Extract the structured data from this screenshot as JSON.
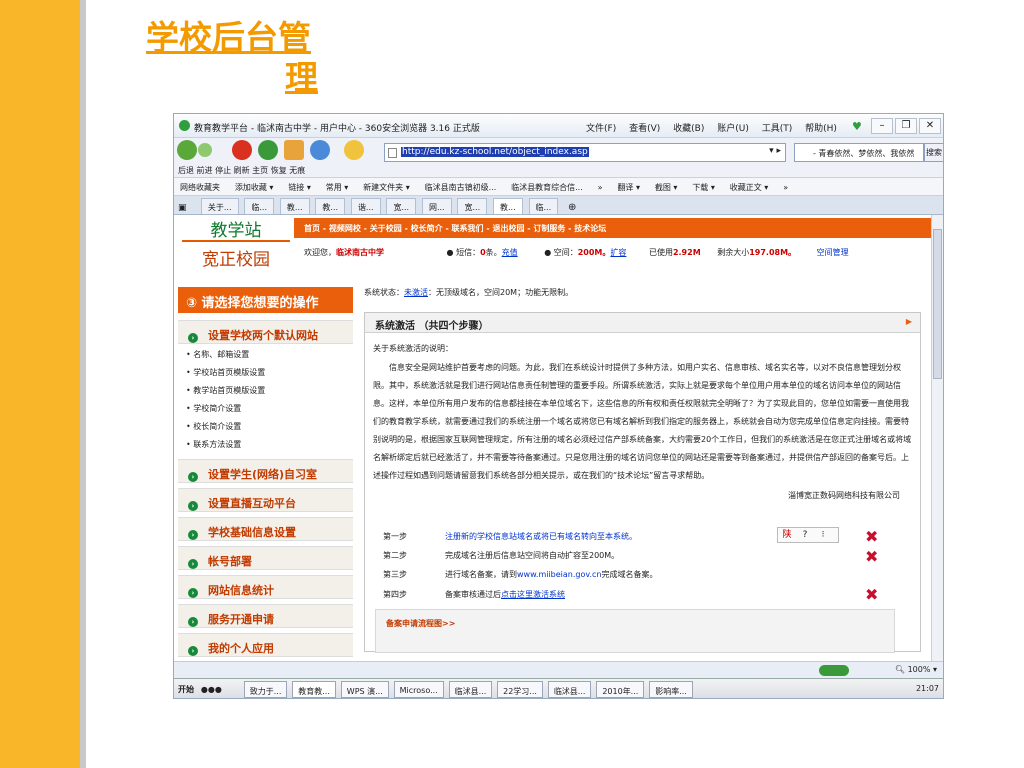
{
  "slide": {
    "title_line1": "学校后台管",
    "title_line2": "理"
  },
  "browser": {
    "window_title": "教育教学平台 - 临沭南古中学 - 用户中心 - 360安全浏览器 3.16 正式版",
    "menu": [
      "文件(F)",
      "查看(V)",
      "收藏(B)",
      "账户(U)",
      "工具(T)",
      "帮助(H)"
    ],
    "nav_labels": "后退 前进  停止  刷新  主页  恢复  无痕",
    "address": "http://edu.kz-school.net/object_index.asp",
    "search_text": "- 青春依然、梦依然、我依然",
    "search_button": "搜索",
    "favorites": [
      "网络收藏夹",
      "添加收藏 ▾",
      "链接 ▾",
      "常用 ▾",
      "新建文件夹 ▾",
      "临沭县南古镇初级...",
      "临沭县教育综合信...",
      "»",
      "翻译 ▾",
      "截图 ▾",
      "下载 ▾",
      "收藏正文 ▾",
      "»"
    ],
    "tabs": [
      "关于...",
      "临...",
      "教...",
      "教...",
      "谐...",
      "宽...",
      "网...",
      "宽...",
      "教...",
      "临..."
    ],
    "zoom": "100% ▾"
  },
  "site": {
    "logo_top": "教学站",
    "logo_bottom": "宽正校园",
    "nav": "首页 - 视频网校 - 关于校园 - 校长简介 - 联系我们 - 退出校园 - 订制服务 - 技术论坛",
    "welcome_prefix": "欢迎您，",
    "school": "临沭南古中学",
    "sms_prefix": "● 短信：",
    "sms_count": "0",
    "sms_suffix": "条。",
    "sms_link": "充值",
    "space_prefix": "● 空间：",
    "space_total": "200M。",
    "space_link": "扩容",
    "used_prefix": "已使用",
    "used_value": "2.92M",
    "remain_prefix": "剩余大小",
    "remain_value": "197.08M。",
    "space_manage": "空间管理"
  },
  "sidebar": {
    "header": "③ 请选择您想要的操作",
    "sections": [
      "设置学校两个默认网站",
      "设置学生(网络)自习室",
      "设置直播互动平台",
      "学校基础信息设置",
      "帐号部署",
      "网站信息统计",
      "服务开通申请",
      "我的个人应用"
    ],
    "subitems": [
      "名称、邮箱设置",
      "学校站首页模版设置",
      "教学站首页模版设置",
      "学校简介设置",
      "校长简介设置",
      "联系方法设置"
    ]
  },
  "main": {
    "status_prefix": "系统状态：",
    "status_link": "未激活",
    "status_suffix": "：无顶级域名，空间20M；功能无限制。",
    "panel_title": "系统激活 （共四个步骤）",
    "intro_title": "关于系统激活的说明：",
    "intro_body": "信息安全是网站维护首要考虑的问题。为此，我们在系统设计时提供了多种方法，如用户实名、信息审核、域名实名等，以对不良信息管理划分权限。其中，系统激活就是我们进行网站信息责任制管理的重要手段。所谓系统激活，实际上就是要求每个单位用户用本单位的域名访问本单位的网站信息。这样，本单位所有用户发布的信息都挂接在本单位域名下，这些信息的所有权和责任权限就完全明晰了？为了实现此目的，您单位如需要一直使用我们的教育教学系统，就需要通过我们的系统注册一个域名或将您已有域名解析到我们指定的服务器上，系统就会自动为您完成单位信息定向挂接。需要特别说明的是，根据国家互联网管理规定，所有注册的域名必须经过信产部系统备案，大约需要20个工作日，但我们的系统激活是在您正式注册域名或将域名解析绑定后就已经激活了，并不需要等待备案通过。只是您用注册的域名访问您单位的网站还是需要等到备案通过，并提供信产部返回的备案号后。上述操作过程如遇到问题请留意我们系统各部分相关提示，或在我们的“技术论坛”留言寻求帮助。",
    "company": "淄博宽正数码网络科技有限公司",
    "steps": [
      {
        "label": "第一步",
        "text": "注册新的学校信息站域名或将已有域名转向至本系统。"
      },
      {
        "label": "第二步",
        "text": "完成域名注册后信息站空间将自动扩容至200M。"
      },
      {
        "label": "第三步",
        "text_a": "进行域名备案，请到",
        "text_link": "www.miibeian.gov.cn",
        "text_b": "完成域名备案。"
      },
      {
        "label": "第四步",
        "text_a": "备案审核通过后",
        "text_link": "点击这里激活系统"
      }
    ],
    "ctrl": [
      "陕",
      "?",
      "⁝"
    ],
    "flow_title": "备案申请流程图>>"
  },
  "taskbar": {
    "start": "开始",
    "items": [
      "致力于...",
      "教育教...",
      "WPS 演...",
      "Microso...",
      "临沭县...",
      "22学习...",
      "临沭县...",
      "2010年...",
      "影响率..."
    ],
    "clock": "21:07"
  }
}
